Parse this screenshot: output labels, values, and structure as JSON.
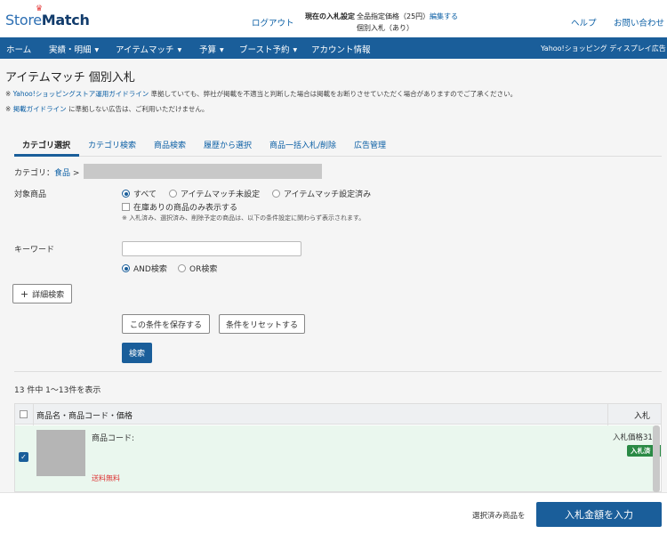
{
  "header": {
    "logo_prefix": "Store",
    "logo_suffix": "Match",
    "logout": "ログアウト",
    "bid_setting_label": "現在の入札設定",
    "bid_setting_value1": "全品指定価格（25円）",
    "bid_setting_edit": "編集する",
    "bid_setting_value2": "個別入札（あり）",
    "help": "ヘルプ",
    "contact": "お問い合わせ"
  },
  "nav": {
    "items": [
      "ホーム",
      "実績・明細",
      "アイテムマッチ",
      "予算",
      "ブースト予約",
      "アカウント情報"
    ],
    "right": "Yahoo!ショッピング ディスプレイ広告"
  },
  "page": {
    "title": "アイテムマッチ 個別入札",
    "notice1_prefix": "※ ",
    "notice1_link": "Yahoo!ショッピングストア運用ガイドライン",
    "notice1_suffix": " 準拠していても、弊社が掲載を不適当と判断した場合は掲載をお断りさせていただく場合がありますのでご了承ください。",
    "notice2_prefix": "※ ",
    "notice2_link": "掲載ガイドライン",
    "notice2_suffix": " に準拠しない広告は、ご利用いただけません。"
  },
  "tabs": [
    "カテゴリ選択",
    "カテゴリ検索",
    "商品検索",
    "履歴から選択",
    "商品一括入札/削除",
    "広告管理"
  ],
  "category": {
    "label": "カテゴリ：",
    "link": "食品",
    "sep": " >"
  },
  "filters": {
    "target_label": "対象商品",
    "options": [
      "すべて",
      "アイテムマッチ未設定",
      "アイテムマッチ設定済み"
    ],
    "in_stock_label": "在庫ありの商品のみ表示する",
    "hint": "※ 入札済み、選択済み、削除予定の商品は、以下の条件設定に関わらず表示されます。",
    "keyword_label": "キーワード",
    "keyword_value": "",
    "logic_options": [
      "AND検索",
      "OR検索"
    ],
    "advanced": "詳細検索",
    "save_btn": "この条件を保存する",
    "reset_btn": "条件をリセットする",
    "search_btn": "検索"
  },
  "results": {
    "count": "13 件中 1〜13件を表示"
  },
  "table": {
    "col_name": "商品名・商品コード・価格",
    "col_bid": "入札",
    "row": {
      "code_label": "商品コード:",
      "free_shipping": "送料無料",
      "bid_price": "入札価格31",
      "badge": "入札済"
    }
  },
  "footer": {
    "text": "選択済み商品を",
    "button": "入札金額を入力"
  }
}
